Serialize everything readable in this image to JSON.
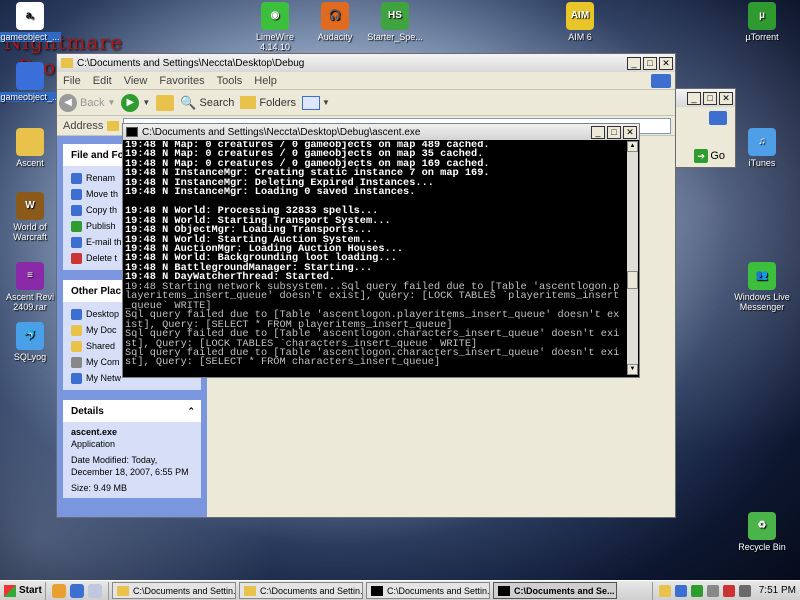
{
  "background": {
    "title_line1": "Nightmare",
    "title_line2": "Pro"
  },
  "desktop_icons": [
    {
      "label": "gameobject_...",
      "color": "#ffffff",
      "glyph": "a,"
    },
    {
      "label": "gameobject_...",
      "color": "#3a6ed8",
      "glyph": ""
    },
    {
      "label": "Ascent",
      "color": "#e8c24a",
      "glyph": ""
    },
    {
      "label": "World of Warcraft",
      "color": "#8b5a1a",
      "glyph": "W"
    },
    {
      "label": "Ascent Revi 2409.rar",
      "color": "#8a2aa8",
      "glyph": "≡"
    },
    {
      "label": "SQLyog",
      "color": "#4aa0e8",
      "glyph": "🐬"
    },
    {
      "label": "LimeWire 4.14.10",
      "color": "#3cbf3c",
      "glyph": "◉"
    },
    {
      "label": "Audacity",
      "color": "#e06a20",
      "glyph": "🎧"
    },
    {
      "label": "Starter_Spe...",
      "color": "#3fa33f",
      "glyph": "HS"
    },
    {
      "label": "AIM 6",
      "color": "#e8c62a",
      "glyph": "AIM"
    },
    {
      "label": "µTorrent",
      "color": "#2f9a2f",
      "glyph": "µ"
    },
    {
      "label": "iTunes",
      "color": "#4f9ee8",
      "glyph": "♫"
    },
    {
      "label": "Windows Live Messenger",
      "color": "#3cbf3c",
      "glyph": "👥"
    },
    {
      "label": "Recycle Bin",
      "color": "#4ab34a",
      "glyph": "♻"
    }
  ],
  "explorer": {
    "title": "C:\\Documents and Settings\\Neccta\\Desktop\\Debug",
    "menu": [
      "File",
      "Edit",
      "View",
      "Favorites",
      "Tools",
      "Help"
    ],
    "toolbar": {
      "back": "Back",
      "search": "Search",
      "folders": "Folders"
    },
    "address_label": "Address",
    "go_label": "Go",
    "file_tasks_title": "File and Fo",
    "file_tasks": [
      "Renam",
      "Move th",
      "Copy th",
      "Publish",
      "E-mail th",
      "Delete t"
    ],
    "other_places_title": "Other Plac",
    "other_places": [
      "Desktop",
      "My Doc",
      "Shared",
      "My Com",
      "My Netw"
    ],
    "details_title": "Details",
    "details": {
      "name": "ascent.exe",
      "type": "Application",
      "modified": "Date Modified: Today, December 18, 2007, 6:55 PM",
      "size": "Size: 9.49 MB"
    }
  },
  "explorer2": {
    "go_label": "Go"
  },
  "console": {
    "title": "C:\\Documents and Settings\\Neccta\\Desktop\\Debug\\ascent.exe",
    "lines": [
      {
        "text": "19:48 N Map: 0 creatures / 0 gameobjects on map 489 cached.",
        "hi": true
      },
      {
        "text": "19:48 N Map: 0 creatures / 0 gameobjects on map 35 cached.",
        "hi": true
      },
      {
        "text": "19:48 N Map: 0 creatures / 0 gameobjects on map 169 cached.",
        "hi": true
      },
      {
        "text": "19:48 N InstanceMgr: Creating static instance 7 on map 169.",
        "hi": true
      },
      {
        "text": "19:48 N InstanceMgr: Deleting Expired Instances...",
        "hi": true
      },
      {
        "text": "19:48 N InstanceMgr: Loading 0 saved instances.",
        "hi": true
      },
      {
        "text": "",
        "hi": false
      },
      {
        "text": "19:48 N World: Processing 32833 spells...",
        "hi": true
      },
      {
        "text": "19:48 N World: Starting Transport System...",
        "hi": true
      },
      {
        "text": "19:48 N ObjectMgr: Loading Transports...",
        "hi": true
      },
      {
        "text": "19:48 N World: Starting Auction System...",
        "hi": true
      },
      {
        "text": "19:48 N AuctionMgr: Loading Auction Houses...",
        "hi": true
      },
      {
        "text": "19:48 N World: Backgrounding loot loading...",
        "hi": true
      },
      {
        "text": "19:48 N BattlegroundManager: Starting...",
        "hi": true
      },
      {
        "text": "19:48 N DayWatcherThread: Started.",
        "hi": true
      },
      {
        "text": "19:48 Starting network subsystem...Sql query failed due to [Table 'ascentlogon.p",
        "hi": false
      },
      {
        "text": "layeritems_insert_queue' doesn't exist], Query: [LOCK TABLES `playeritems_insert",
        "hi": false
      },
      {
        "text": "_queue` WRITE]",
        "hi": false
      },
      {
        "text": "Sql query failed due to [Table 'ascentlogon.playeritems_insert_queue' doesn't ex",
        "hi": false
      },
      {
        "text": "ist], Query: [SELECT * FROM playeritems_insert_queue]",
        "hi": false
      },
      {
        "text": "Sql query failed due to [Table 'ascentlogon.characters_insert_queue' doesn't exi",
        "hi": false
      },
      {
        "text": "st], Query: [LOCK TABLES `characters_insert_queue` WRITE]",
        "hi": false
      },
      {
        "text": "Sql query failed due to [Table 'ascentlogon.characters_insert_queue' doesn't exi",
        "hi": false
      },
      {
        "text": "st], Query: [SELECT * FROM characters_insert_queue]",
        "hi": false
      }
    ]
  },
  "taskbar": {
    "start_label": "Start",
    "buttons": [
      {
        "label": "C:\\Documents and Settin...",
        "active": false,
        "kind": "folder"
      },
      {
        "label": "C:\\Documents and Settin...",
        "active": false,
        "kind": "folder"
      },
      {
        "label": "C:\\Documents and Settin...",
        "active": false,
        "kind": "console"
      },
      {
        "label": "C:\\Documents and Se...",
        "active": true,
        "kind": "console"
      }
    ],
    "clock": "7:51 PM"
  }
}
